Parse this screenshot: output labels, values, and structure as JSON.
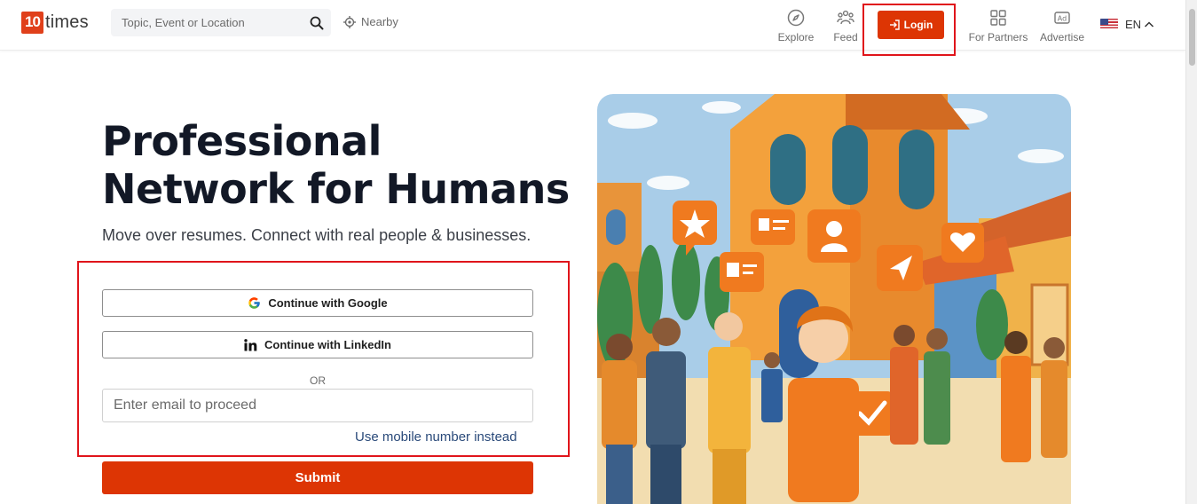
{
  "header": {
    "logo": {
      "number": "10",
      "text": "times"
    },
    "search": {
      "placeholder": "Topic, Event or Location",
      "icon": "search-icon"
    },
    "nearby": {
      "label": "Nearby",
      "icon": "location-target-icon"
    },
    "nav": {
      "explore": "Explore",
      "feed": "Feed",
      "login": "Login",
      "partners": "For Partners",
      "advertise": "Advertise"
    },
    "language": {
      "code": "EN",
      "flag": "us-flag-icon",
      "icon": "chevron-up-icon"
    }
  },
  "hero": {
    "title": "Professional Network for Humans",
    "subtitle": "Move over resumes. Connect with real people & businesses."
  },
  "form": {
    "google_label": "Continue with Google",
    "linkedin_label": "Continue with LinkedIn",
    "or_label": "OR",
    "email_placeholder": "Enter email to proceed",
    "mobile_link": "Use mobile number instead",
    "submit_label": "Submit"
  },
  "colors": {
    "brand": "#dd3504",
    "highlight_border": "#e0151b",
    "title": "#121826"
  }
}
